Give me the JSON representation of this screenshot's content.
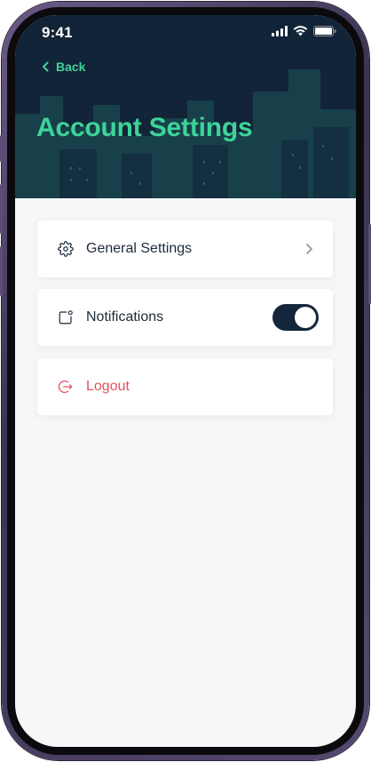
{
  "status_bar": {
    "time": "9:41",
    "icons": [
      "cellular-signal-icon",
      "wifi-icon",
      "battery-icon"
    ]
  },
  "header": {
    "back_label": "Back",
    "back_icon": "chevron-left-icon",
    "title": "Account Settings",
    "background_color": "#122437",
    "accent_color": "#3ed39a"
  },
  "settings": {
    "general": {
      "label": "General Settings",
      "icon": "gear-icon",
      "trailing_icon": "chevron-right-icon"
    },
    "notifications": {
      "label": "Notifications",
      "icon": "notification-badge-icon",
      "toggle_on": true
    },
    "logout": {
      "label": "Logout",
      "icon": "logout-icon",
      "color": "#e8505b"
    }
  }
}
